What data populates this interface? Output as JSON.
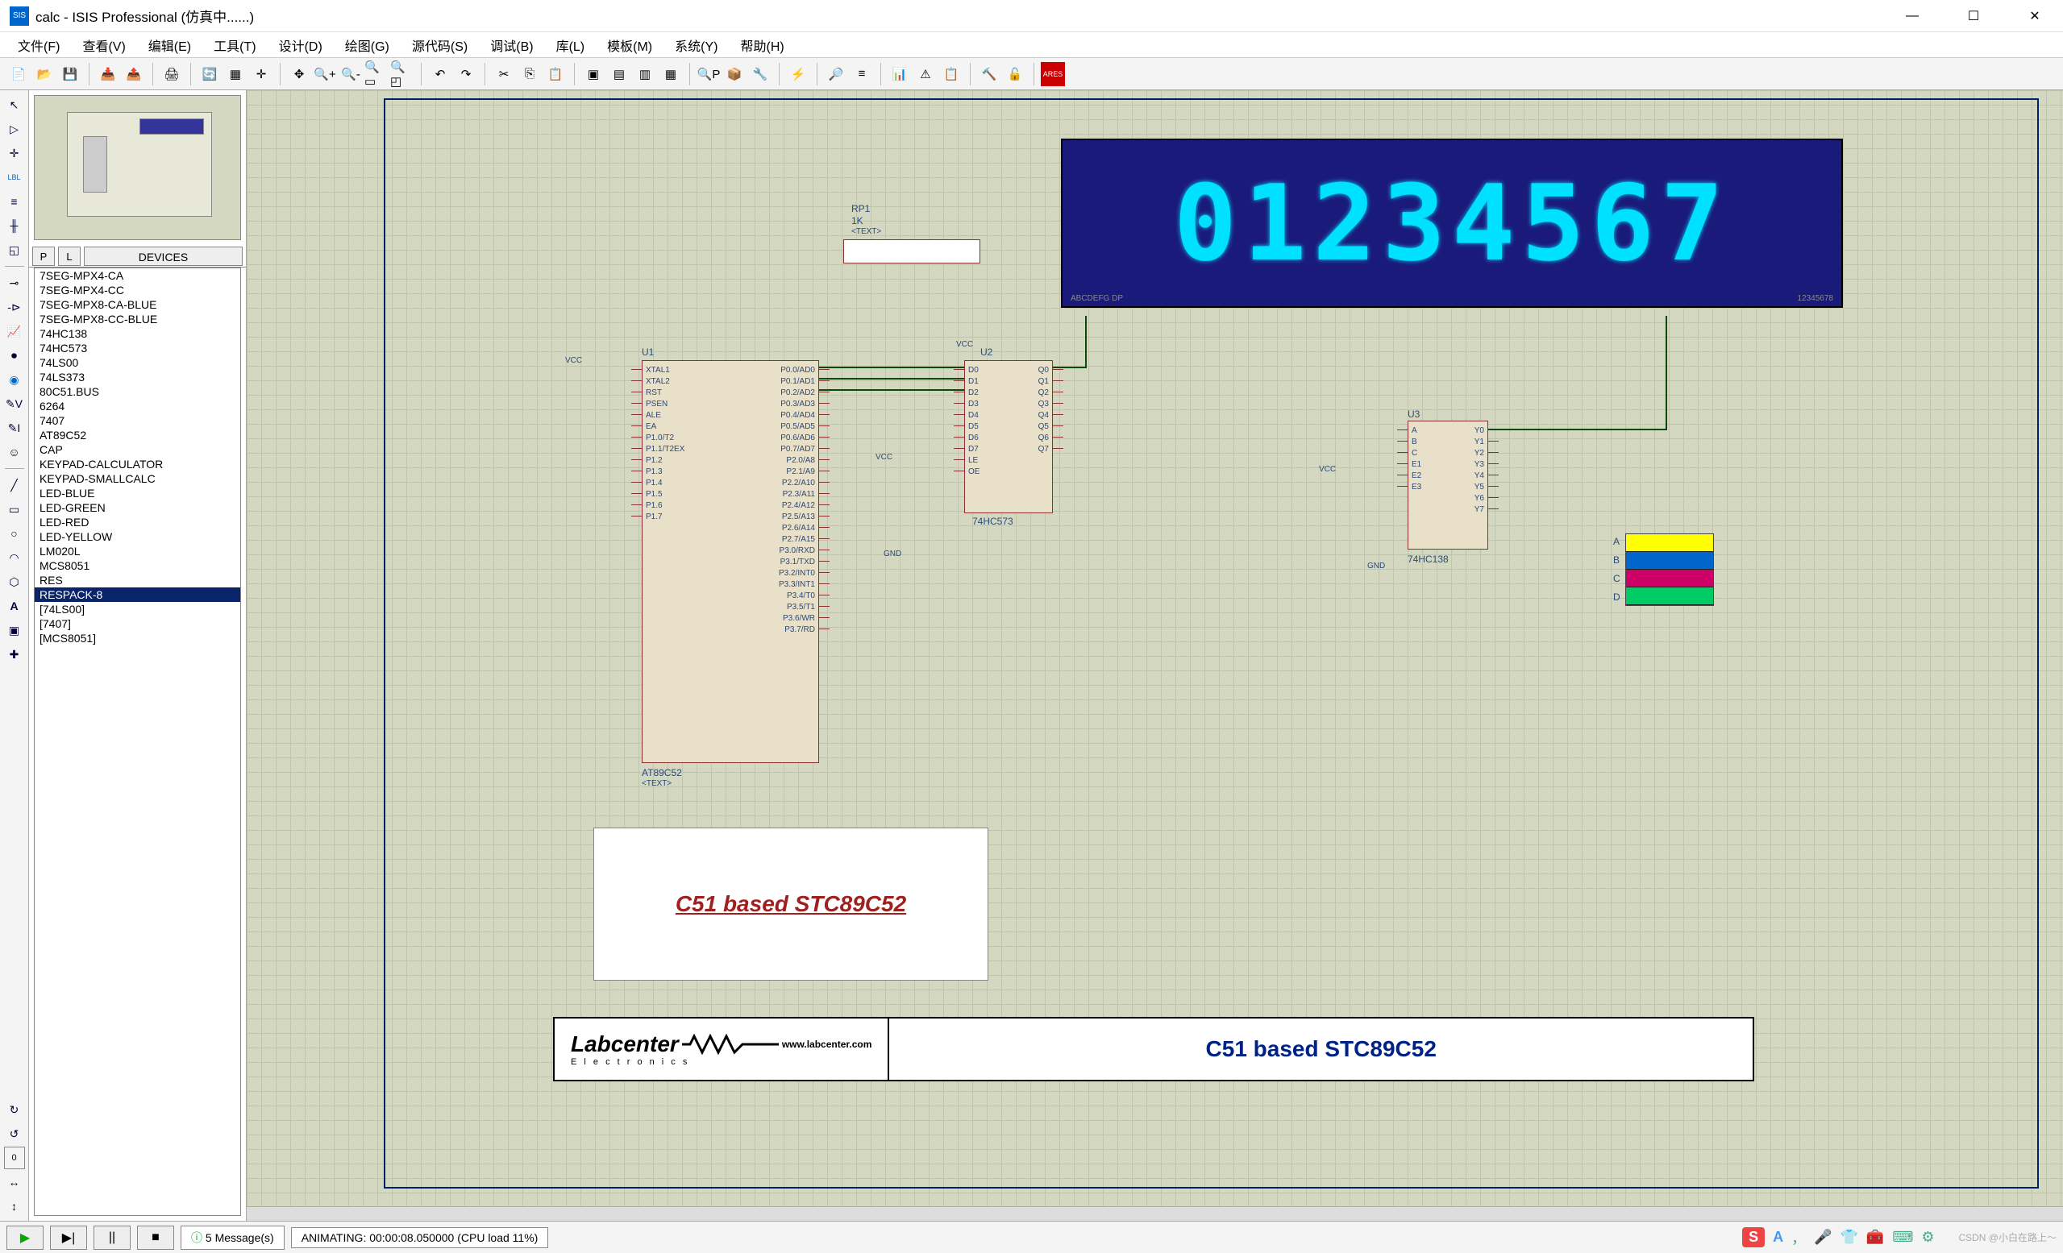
{
  "window": {
    "app_icon": "SIS",
    "title": "calc - ISIS Professional (仿真中......)",
    "min": "—",
    "max": "☐",
    "close": "✕"
  },
  "menus": [
    "文件(F)",
    "查看(V)",
    "编辑(E)",
    "工具(T)",
    "设计(D)",
    "绘图(G)",
    "源代码(S)",
    "调试(B)",
    "库(L)",
    "模板(M)",
    "系统(Y)",
    "帮助(H)"
  ],
  "sidepanel": {
    "p_btn": "P",
    "l_btn": "L",
    "header": "DEVICES",
    "devices": [
      "7SEG-MPX4-CA",
      "7SEG-MPX4-CC",
      "7SEG-MPX8-CA-BLUE",
      "7SEG-MPX8-CC-BLUE",
      "74HC138",
      "74HC573",
      "74LS00",
      "74LS373",
      "80C51.BUS",
      "6264",
      "7407",
      "AT89C52",
      "CAP",
      "KEYPAD-CALCULATOR",
      "KEYPAD-SMALLCALC",
      "LED-BLUE",
      "LED-GREEN",
      "LED-RED",
      "LED-YELLOW",
      "LM020L",
      "MCS8051",
      "RES",
      "RESPACK-8",
      "[74LS00]",
      "[7407]",
      "[MCS8051]"
    ],
    "selected_index": 22
  },
  "schematic": {
    "u1_ref": "U1",
    "u1_part": "AT89C52",
    "u1_text": "<TEXT>",
    "u1_pins_left": [
      "XTAL1",
      "XTAL2",
      "RST",
      "PSEN",
      "ALE",
      "EA",
      "P1.0/T2",
      "P1.1/T2EX",
      "P1.2",
      "P1.3",
      "P1.4",
      "P1.5",
      "P1.6",
      "P1.7"
    ],
    "u1_pins_right": [
      "P0.0/AD0",
      "P0.1/AD1",
      "P0.2/AD2",
      "P0.3/AD3",
      "P0.4/AD4",
      "P0.5/AD5",
      "P0.6/AD6",
      "P0.7/AD7",
      "P2.0/A8",
      "P2.1/A9",
      "P2.2/A10",
      "P2.3/A11",
      "P2.4/A12",
      "P2.5/A13",
      "P2.6/A14",
      "P2.7/A15",
      "P3.0/RXD",
      "P3.1/TXD",
      "P3.2/INT0",
      "P3.3/INT1",
      "P3.4/T0",
      "P3.5/T1",
      "P3.6/WR",
      "P3.7/RD"
    ],
    "u2_ref": "U2",
    "u2_part": "74HC573",
    "u2_pins_left": [
      "D0",
      "D1",
      "D2",
      "D3",
      "D4",
      "D5",
      "D6",
      "D7",
      "LE",
      "OE"
    ],
    "u2_pins_right": [
      "Q0",
      "Q1",
      "Q2",
      "Q3",
      "Q4",
      "Q5",
      "Q6",
      "Q7"
    ],
    "u3_ref": "U3",
    "u3_part": "74HC138",
    "u3_pins_left": [
      "A",
      "B",
      "C",
      "E1",
      "E2",
      "E3"
    ],
    "u3_pins_right": [
      "Y0",
      "Y1",
      "Y2",
      "Y3",
      "Y4",
      "Y5",
      "Y6",
      "Y7"
    ],
    "rp1_ref": "RP1",
    "rp1_val": "1K",
    "rp1_text": "<TEXT>",
    "vcc": "VCC",
    "gnd": "GND",
    "display_value": "01234567",
    "display_pins_left": "ABCDEFG  DP",
    "display_pins_right": "12345678",
    "scope_labels": [
      "A",
      "B",
      "C",
      "D"
    ],
    "textbox": "C51 based STC89C52",
    "titleblock_logo": "Labcenter",
    "titleblock_sub": "E l e c t r o n i c s",
    "titleblock_url": "www.labcenter.com",
    "titleblock_caption": "C51 based STC89C52"
  },
  "statusbar": {
    "play": "▶",
    "step": "▶|",
    "pause": "||",
    "stop": "■",
    "msg_icon": "ⓘ",
    "msg_count": "5 Message(s)",
    "anim": "ANIMATING: 00:00:08.050000 (CPU load 11%)",
    "ime_s": "S",
    "ime_a": "A",
    "watermark": "CSDN @小白在路上～"
  }
}
